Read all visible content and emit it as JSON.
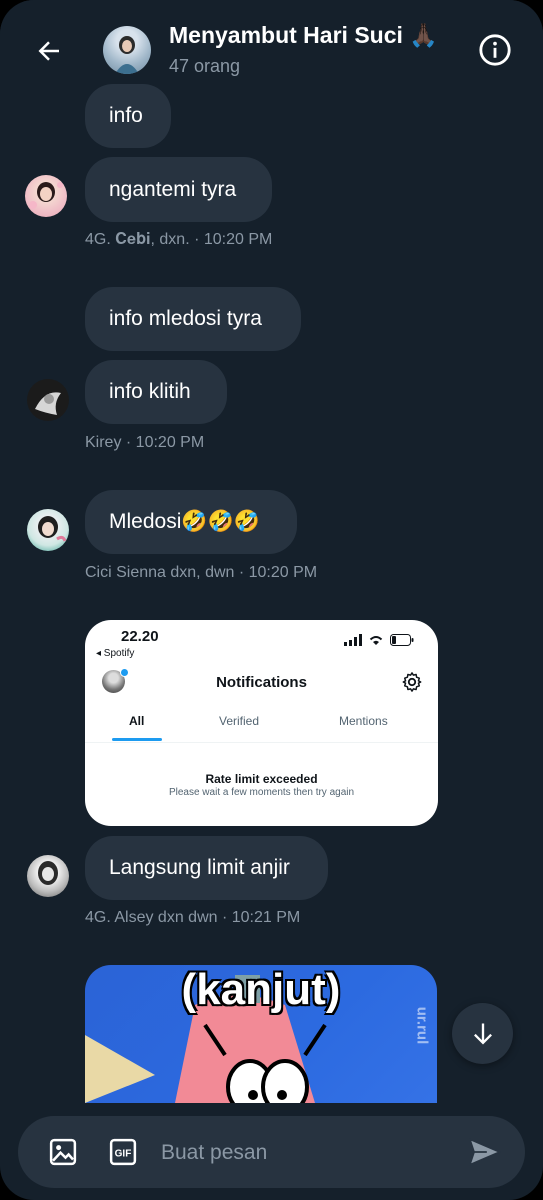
{
  "header": {
    "title": "Menyambut Hari Suci 🙏🏿",
    "member_count": "47 orang"
  },
  "messages": [
    {
      "text": "info"
    },
    {
      "text": "ngantemi tyra"
    },
    {
      "meta": "4G. 𝐂𝐞𝐛𝐢, dxn. · 10:20 PM"
    },
    {
      "text": "info mledosi tyra"
    },
    {
      "text": "info klitih"
    },
    {
      "meta": "Kirey · 10:20 PM"
    },
    {
      "text": "Mledosi🤣🤣🤣"
    },
    {
      "meta": "Cici Sienna dxn, dwn · 10:20 PM"
    },
    {
      "text": "Langsung limit anjir"
    },
    {
      "meta": "4G. Alsey dxn dwn · 10:21 PM"
    }
  ],
  "shared_screenshot": {
    "time": "22.20",
    "back_app": "◂ Spotify",
    "title": "Notifications",
    "tabs": [
      "All",
      "Verified",
      "Mentions"
    ],
    "error_title": "Rate limit exceeded",
    "error_sub": "Please wait a few moments then try again"
  },
  "meme": {
    "caption": "(kanjut)",
    "watermark": "ur.rul"
  },
  "composer": {
    "placeholder": "Buat pesan"
  },
  "colors": {
    "background": "#15202b",
    "bubble": "#273340",
    "secondary_text": "#8b98a5",
    "accent": "#1d9bf0"
  },
  "icons": {
    "back": "arrow-left-icon",
    "info": "info-icon",
    "scroll": "arrow-down-icon",
    "image": "image-icon",
    "gif": "gif-icon",
    "send": "send-icon"
  }
}
